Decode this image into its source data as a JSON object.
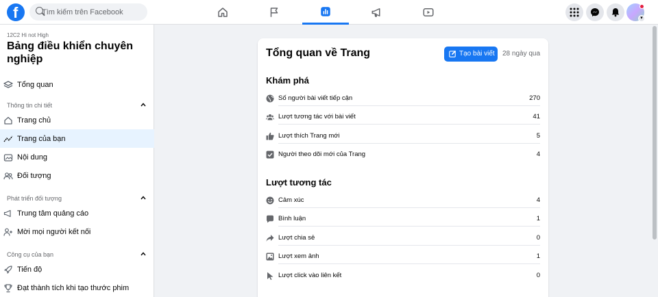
{
  "search": {
    "placeholder": "Tìm kiếm trên Facebook"
  },
  "nav": {
    "tabs": [
      {
        "icon": "home-icon"
      },
      {
        "icon": "flag-icon"
      },
      {
        "icon": "insights-icon",
        "active": true
      },
      {
        "icon": "megaphone-icon"
      },
      {
        "icon": "video-icon"
      }
    ],
    "right": [
      "menu-grid-icon",
      "messenger-icon",
      "bell-icon",
      "avatar"
    ]
  },
  "sidebar": {
    "subtitle": "12C2 Hi not High",
    "title": "Bảng điều khiển chuyên nghiệp",
    "overview": "Tổng quan",
    "sections": [
      {
        "label": "Thông tin chi tiết",
        "items": [
          "Trang chủ",
          "Trang của bạn",
          "Nội dung",
          "Đối tượng"
        ]
      },
      {
        "label": "Phát triển đối tượng",
        "items": [
          "Trung tâm quảng cáo",
          "Mời mọi người kết nối"
        ]
      },
      {
        "label": "Công cụ của bạn",
        "items": [
          "Tiến độ",
          "Đạt thành tích khi tạo thước phim"
        ]
      }
    ],
    "active_item": "Trang của bạn"
  },
  "main": {
    "title": "Tổng quan về Trang",
    "create_button": "Tạo bài viết",
    "range": "28 ngày qua",
    "discover": {
      "heading": "Khám phá",
      "metrics": [
        {
          "label": "Số người bài viết tiếp cận",
          "value": "270",
          "icon": "globe-icon"
        },
        {
          "label": "Lượt tương tác với bài viết",
          "value": "41",
          "icon": "people-icon"
        },
        {
          "label": "Lượt thích Trang mới",
          "value": "5",
          "icon": "thumbs-up-icon"
        },
        {
          "label": "Người theo dõi mới của Trang",
          "value": "4",
          "icon": "follower-icon"
        }
      ]
    },
    "engagement": {
      "heading": "Lượt tương tác",
      "metrics": [
        {
          "label": "Cảm xúc",
          "value": "4",
          "icon": "smiley-icon"
        },
        {
          "label": "Bình luận",
          "value": "1",
          "icon": "comment-icon"
        },
        {
          "label": "Lượt chia sẻ",
          "value": "0",
          "icon": "share-icon"
        },
        {
          "label": "Lượt xem ảnh",
          "value": "1",
          "icon": "photo-icon"
        },
        {
          "label": "Lượt click vào liên kết",
          "value": "0",
          "icon": "cursor-icon"
        }
      ]
    }
  },
  "colors": {
    "accent": "#1877f2",
    "active_bg": "#e7f3ff",
    "notification": "#e41e3f"
  }
}
